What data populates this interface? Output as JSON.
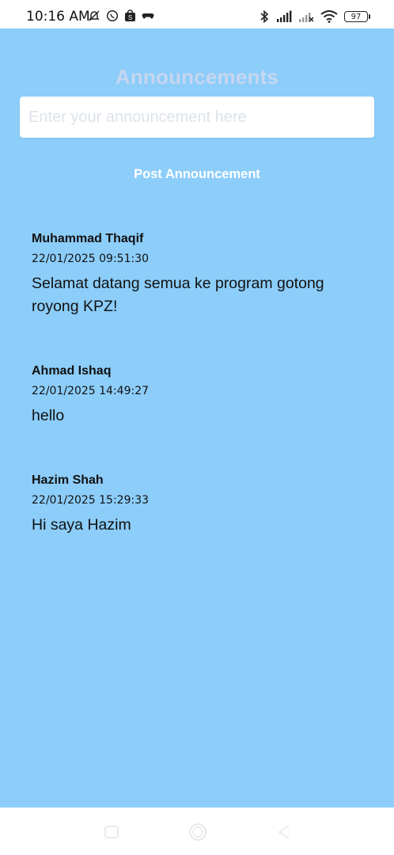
{
  "status_bar": {
    "time": "10:16 AM",
    "left_icons": [
      "muted-bell-icon",
      "whatsapp-icon",
      "shopee-icon",
      "gamepad-icon"
    ],
    "right_icons": [
      "bluetooth-icon",
      "signal-icon",
      "signal-no-service-icon",
      "wifi-icon"
    ],
    "battery": "97"
  },
  "app": {
    "background": "#8ccdfa",
    "title": "Announcements",
    "input": {
      "placeholder": "Enter your announcement here",
      "value": ""
    },
    "post_button_label": "Post Announcement",
    "announcements": [
      {
        "author": "Muhammad Thaqif",
        "timestamp": "22/01/2025 09:51:30",
        "message": "Selamat datang semua ke program gotong royong KPZ!"
      },
      {
        "author": "Ahmad Ishaq",
        "timestamp": "22/01/2025 14:49:27",
        "message": "hello"
      },
      {
        "author": "Hazim Shah",
        "timestamp": "22/01/2025 15:29:33",
        "message": "Hi saya Hazim"
      }
    ]
  },
  "nav_bar": {
    "buttons": [
      "recent-apps-icon",
      "home-icon",
      "back-icon"
    ]
  }
}
